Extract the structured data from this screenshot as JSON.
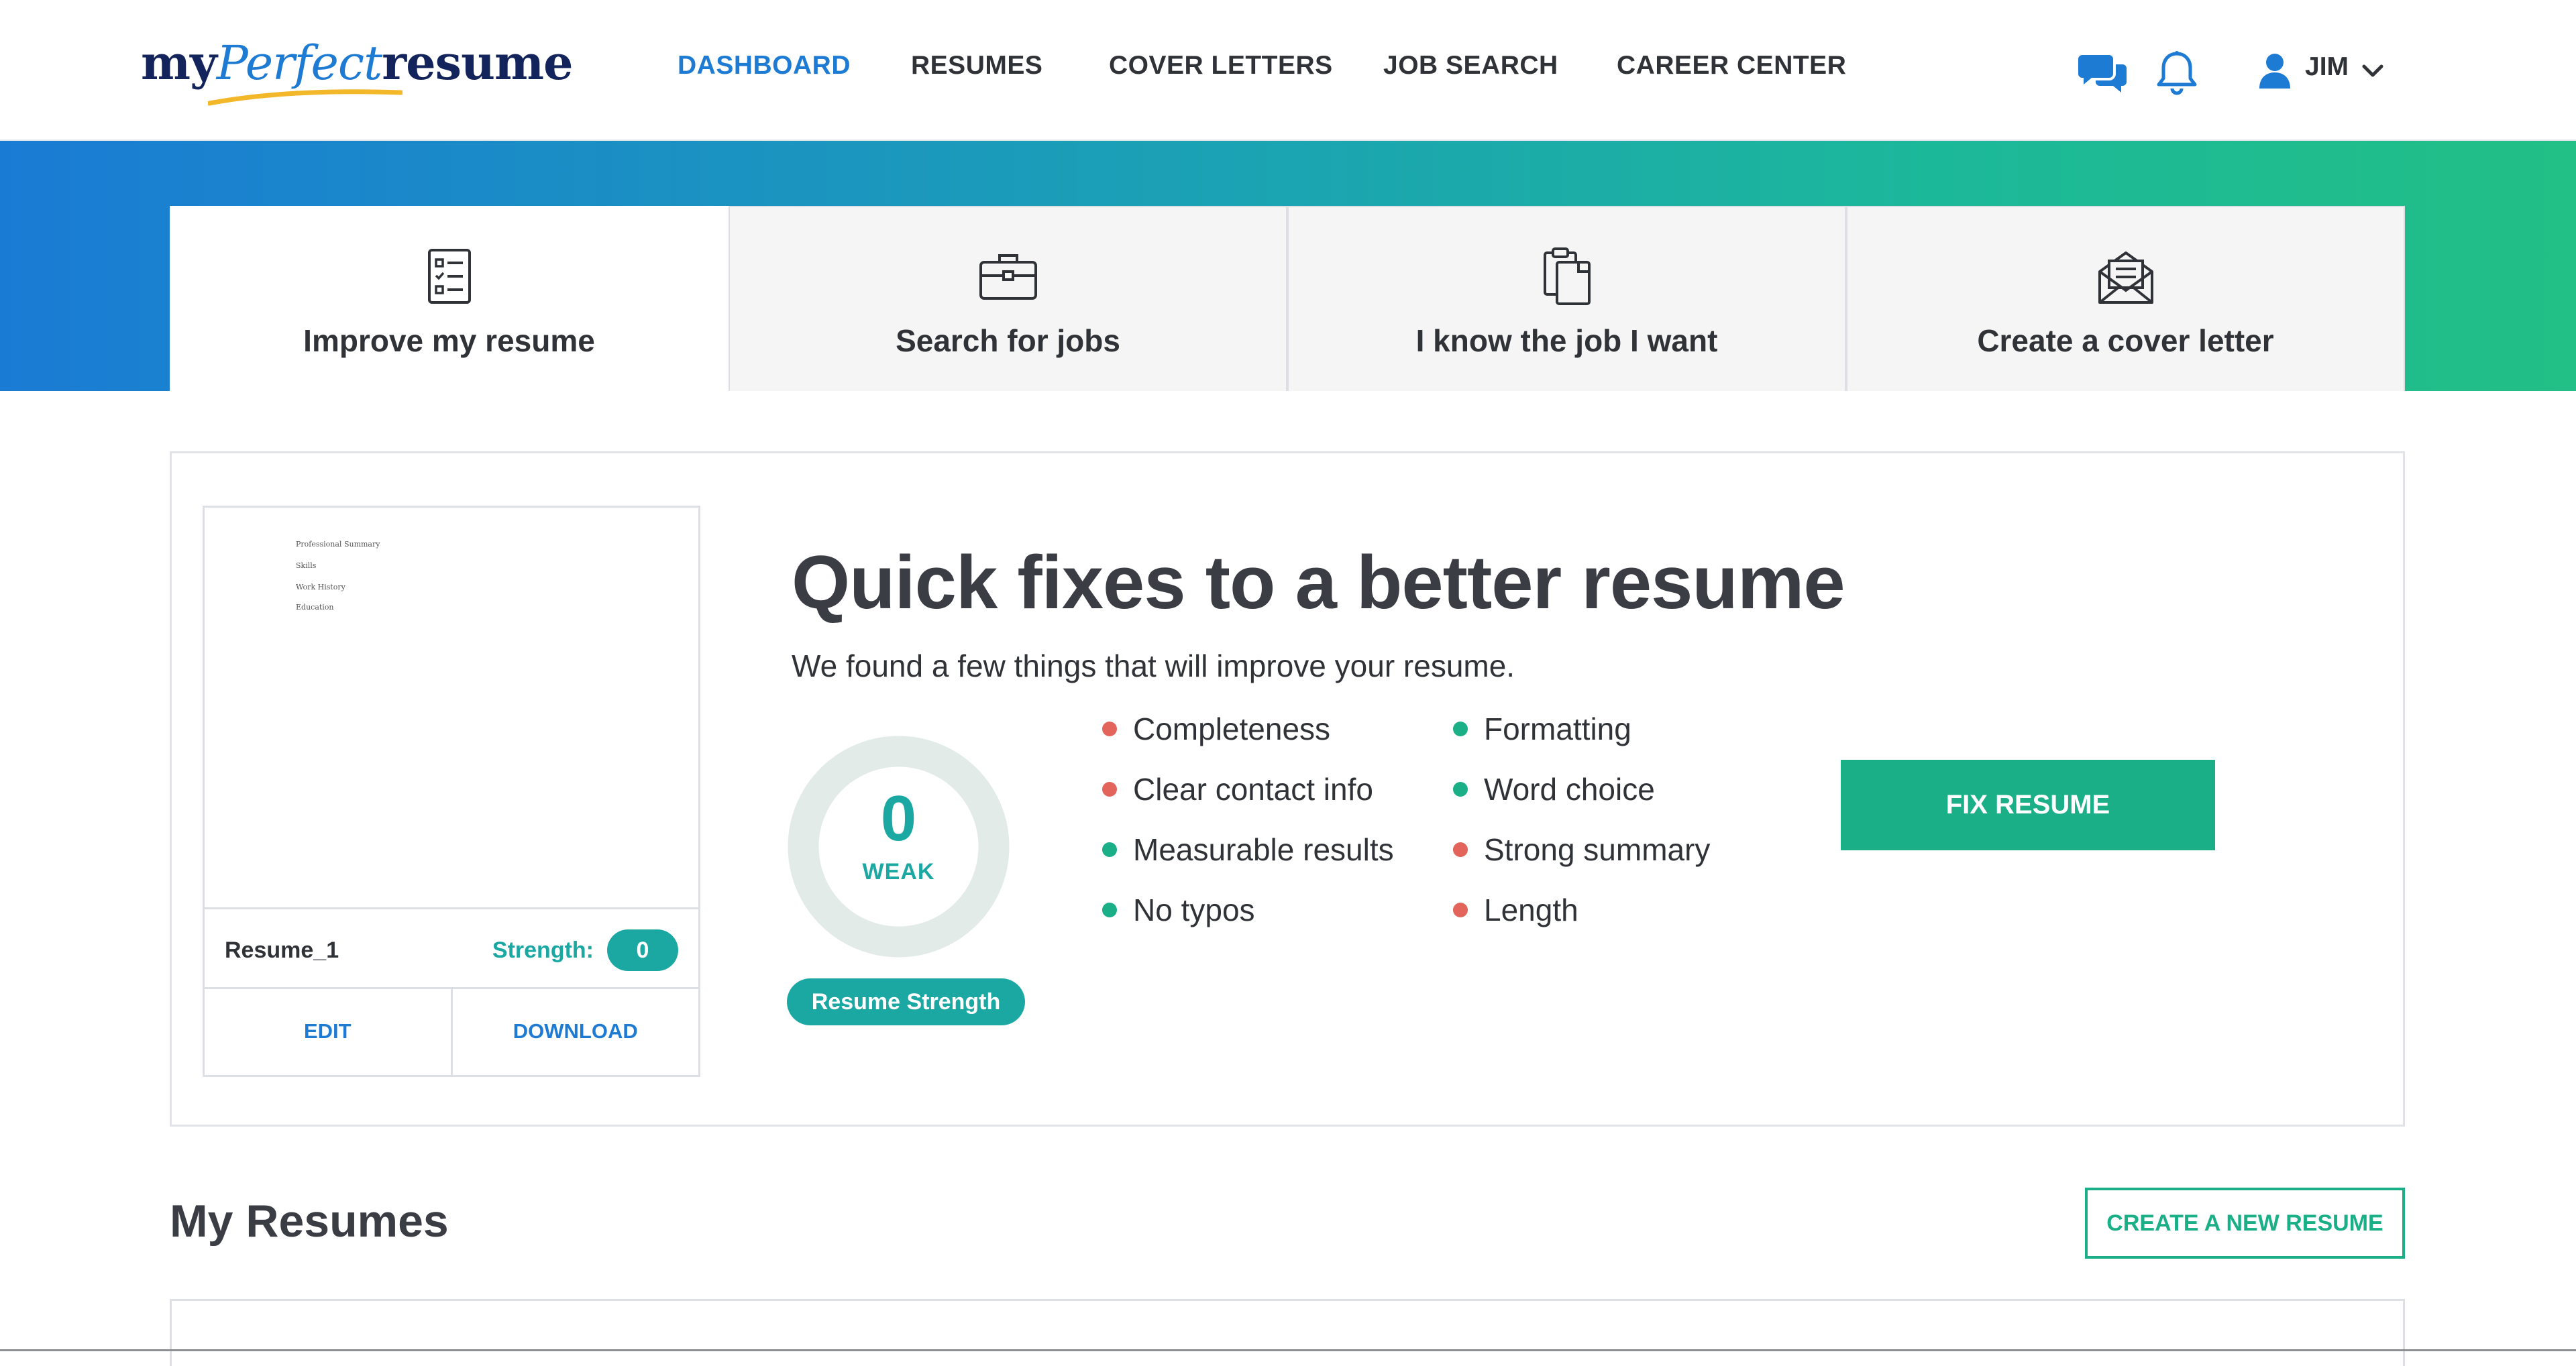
{
  "brand": {
    "logo_my": "my",
    "logo_perfect": "Perfect",
    "logo_resume": "resume"
  },
  "nav": {
    "items": [
      {
        "label": "DASHBOARD",
        "active": true
      },
      {
        "label": "RESUMES",
        "active": false
      },
      {
        "label": "COVER LETTERS",
        "active": false
      },
      {
        "label": "JOB SEARCH",
        "active": false
      },
      {
        "label": "CAREER CENTER",
        "active": false
      }
    ],
    "user_name": "JIM",
    "icons": [
      "chat-icon",
      "bell-icon",
      "user-icon",
      "chevron-down-icon"
    ]
  },
  "tabs": [
    {
      "label": "Improve my resume",
      "icon": "checklist-icon",
      "active": true
    },
    {
      "label": "Search for jobs",
      "icon": "briefcase-icon",
      "active": false
    },
    {
      "label": "I know the job I want",
      "icon": "clipboard-icon",
      "active": false
    },
    {
      "label": "Create a cover letter",
      "icon": "envelope-icon",
      "active": false
    }
  ],
  "resume_card": {
    "preview_lines": [
      "Professional Summary",
      "Skills",
      "Work History",
      "Education"
    ],
    "name": "Resume_1",
    "strength_label": "Strength:",
    "strength_value": "0",
    "edit_label": "EDIT",
    "download_label": "DOWNLOAD"
  },
  "quick_fixes": {
    "title": "Quick fixes to a better resume",
    "subtitle": "We found a few things that will improve your resume.",
    "score": "0",
    "score_label": "WEAK",
    "score_pill": "Resume Strength",
    "checks_left": [
      {
        "label": "Completeness",
        "status": "bad"
      },
      {
        "label": "Clear contact info",
        "status": "bad"
      },
      {
        "label": "Measurable results",
        "status": "good"
      },
      {
        "label": "No typos",
        "status": "good"
      }
    ],
    "checks_right": [
      {
        "label": "Formatting",
        "status": "good"
      },
      {
        "label": "Word choice",
        "status": "good"
      },
      {
        "label": "Strong summary",
        "status": "bad"
      },
      {
        "label": "Length",
        "status": "bad"
      }
    ],
    "fix_button": "FIX RESUME"
  },
  "my_resumes": {
    "title": "My Resumes",
    "create_button": "CREATE A NEW RESUME"
  },
  "colors": {
    "brand_blue": "#1e7bd3",
    "teal": "#1ba8a3",
    "green": "#1aaf86",
    "status_bad": "#e2645a",
    "status_good": "#1aaf86",
    "text_dark": "#2f3237"
  }
}
